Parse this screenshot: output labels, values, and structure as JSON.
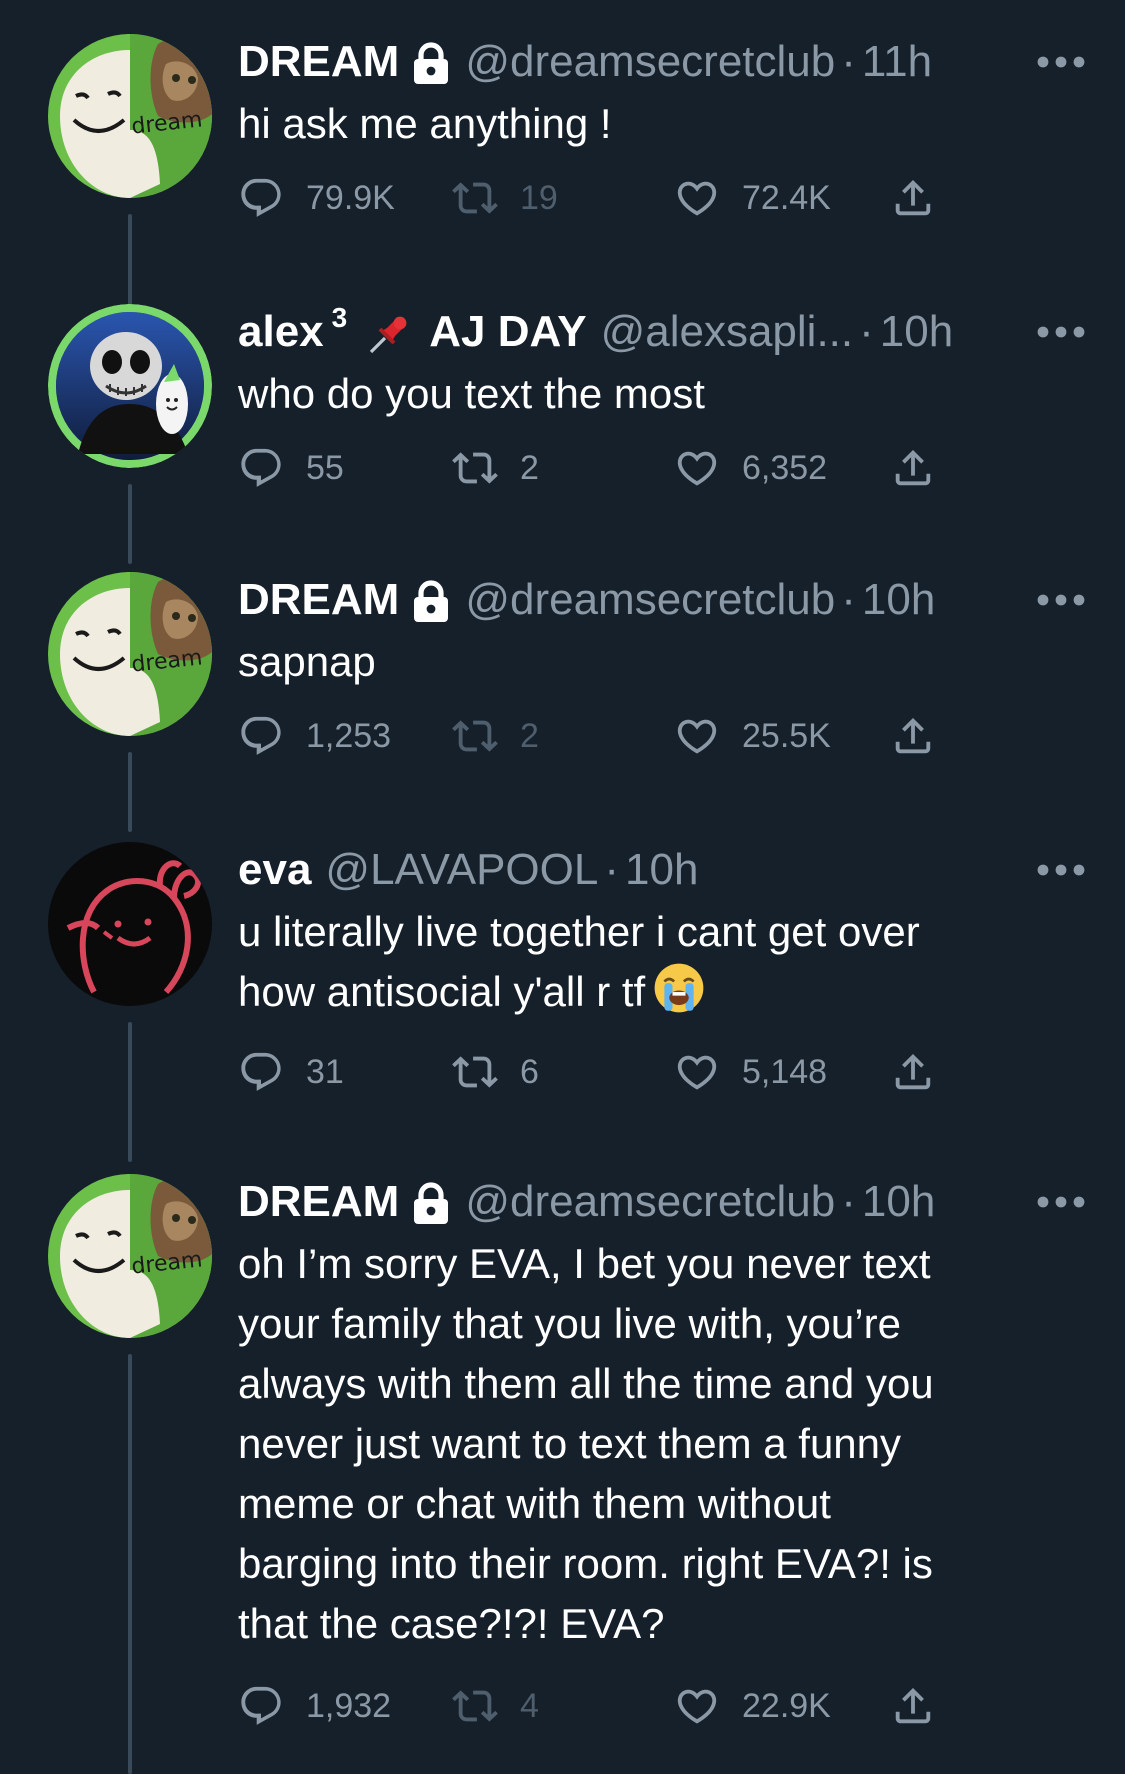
{
  "tweets": [
    {
      "name": "DREAM",
      "protected": true,
      "handle": "@dreamsecretclub",
      "dot": "·",
      "time": "11h",
      "text": "hi ask me anything !",
      "replies": "79.9K",
      "retweets": "19",
      "likes": "72.4K",
      "avatar_label": "dream"
    },
    {
      "name": "alex",
      "name_sup": "3",
      "name_suffix": "AJ DAY",
      "protected": false,
      "handle": "@alexsapli...",
      "dot": "·",
      "time": "10h",
      "text": "who do you text the most",
      "replies": "55",
      "retweets": "2",
      "likes": "6,352"
    },
    {
      "name": "DREAM",
      "protected": true,
      "handle": "@dreamsecretclub",
      "dot": "·",
      "time": "10h",
      "text": "sapnap",
      "replies": "1,253",
      "retweets": "2",
      "likes": "25.5K",
      "avatar_label": "dream"
    },
    {
      "name": "eva",
      "protected": false,
      "handle": "@LAVAPOOL",
      "dot": "·",
      "time": "10h",
      "text_lines": [
        "u literally live together i cant get over",
        "how antisocial y'all r tf"
      ],
      "replies": "31",
      "retweets": "6",
      "likes": "5,148"
    },
    {
      "name": "DREAM",
      "protected": true,
      "handle": "@dreamsecretclub",
      "dot": "·",
      "time": "10h",
      "text_lines": [
        "oh I’m sorry EVA, I bet you never text",
        "your family that you live with, you’re",
        "always with them all the time and you",
        "never just want to text them a funny",
        "meme or chat with them without",
        "barging into their room. right EVA?! is",
        "that the case?!?! EVA?"
      ],
      "replies": "1,932",
      "retweets": "4",
      "likes": "22.9K",
      "avatar_label": "dream"
    }
  ],
  "colors": {
    "background": "#15202b",
    "secondary_text": "#8b98a5",
    "thread_line": "#3a4a59",
    "avatar_ring_green": "#7bd86b"
  },
  "icons": [
    "reply-icon",
    "retweet-icon",
    "like-icon",
    "share-icon",
    "more-icon",
    "lock-icon",
    "pushpin-icon",
    "crying-emoji-icon"
  ]
}
